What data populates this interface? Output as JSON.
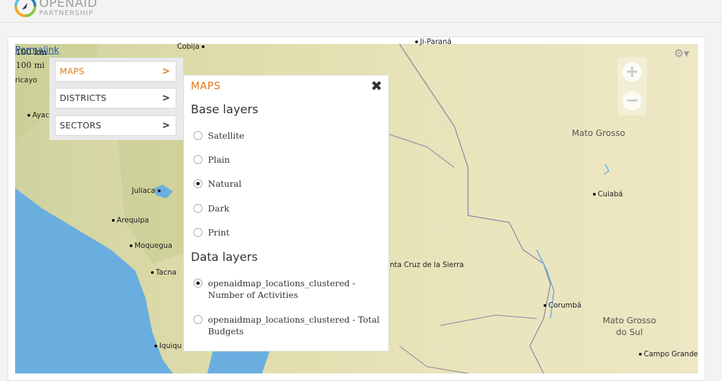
{
  "header": {
    "logo_title": "OPENAID",
    "logo_subtitle": "PARTNERSHIP"
  },
  "map": {
    "permalink": "Permalink",
    "scale_km": "100 km",
    "scale_mi": "100 mi",
    "zoom_in": "+",
    "zoom_out": "−",
    "places": {
      "cobija": "Cobija",
      "ji_parana": "Ji-Paraná",
      "ricayo": "ricayo",
      "ayacucho": "Ayacu",
      "juliaca": "Juliaca",
      "arequipa": "Arequipa",
      "moquegua": "Moquegua",
      "tacna": "Tacna",
      "iquique": "Iquiqu",
      "santa_cruz": "nta Cruz de la Sierra",
      "cuiaba": "Cuiabá",
      "corumba": "Corumbá",
      "campo_grande": "Campo Grande"
    },
    "regions": {
      "mato_grosso": "Mato Grosso",
      "mato_grosso_do_sul_1": "Mato Grosso",
      "mato_grosso_do_sul_2": "do Sul"
    }
  },
  "menu": {
    "items": [
      {
        "label": "MAPS"
      },
      {
        "label": "DISTRICTS"
      },
      {
        "label": "SECTORS"
      }
    ]
  },
  "panel": {
    "title": "MAPS",
    "close": "✖",
    "base_heading": "Base layers",
    "base_layers": [
      {
        "label": "Satellite",
        "checked": false
      },
      {
        "label": "Plain",
        "checked": false
      },
      {
        "label": "Natural",
        "checked": true
      },
      {
        "label": "Dark",
        "checked": false
      },
      {
        "label": "Print",
        "checked": false
      }
    ],
    "data_heading": "Data layers",
    "data_layers": [
      {
        "label": "openaidmap_locations_clustered - Number of Activities",
        "checked": true
      },
      {
        "label": "openaidmap_locations_clustered - Total Budgets",
        "checked": false
      }
    ]
  },
  "colors": {
    "accent": "#e07a1e",
    "ocean": "#6aaee0",
    "land": "#e8dfb4"
  }
}
